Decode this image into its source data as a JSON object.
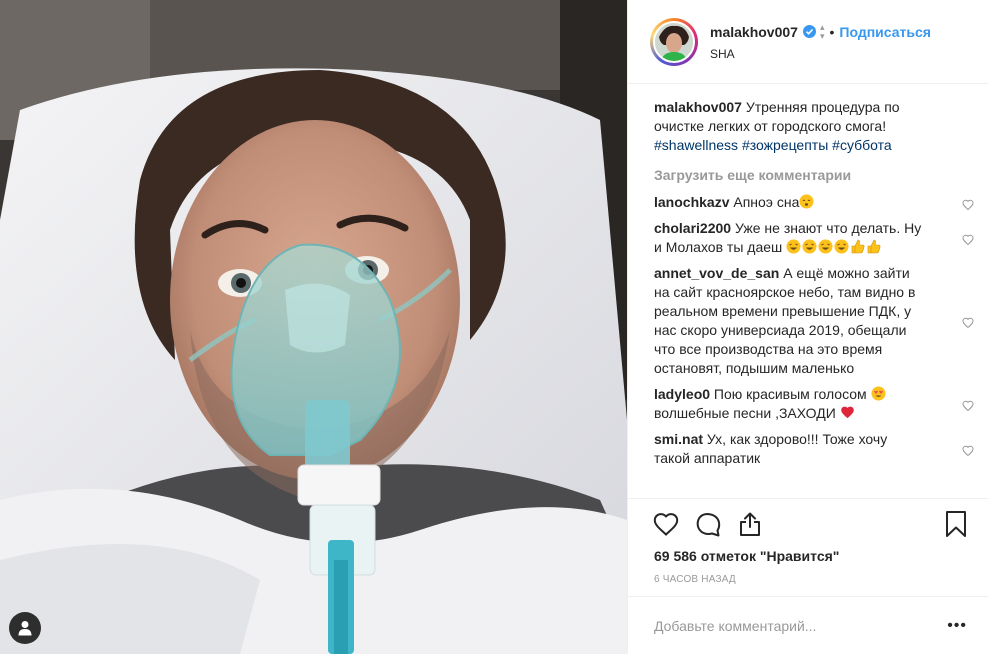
{
  "post": {
    "username": "malakhov007",
    "follow_label": "Подписаться",
    "location": "SHA",
    "caption": {
      "username": "malakhov007",
      "text": "Утренняя процедура по очистке легких от городского смога!",
      "hashtags": [
        "#shawellness",
        "#зожрецепты",
        "#суббота"
      ]
    },
    "load_more_label": "Загрузить еще комментарии",
    "comments": [
      {
        "username": "lanochkazv",
        "text": "Апноэ сна"
      },
      {
        "username": "cholari2200",
        "text": "Уже не знают что делать. Ну и Молахов ты даеш"
      },
      {
        "username": "annet_vov_de_san",
        "text": "А ещё можно зайти на сайт красноярское небо, там видно в реальном времени превышение ПДК, у нас скоро универсиада 2019, обещали что все производства на это время остановят, подышим маленько"
      },
      {
        "username": "ladyleo0",
        "text": "Пою красивым голосом",
        "text2": "волшебные песни ,ЗАХОДИ"
      },
      {
        "username": "smi.nat",
        "text": "Ух, как здорово!!! Тоже хочу такой аппаратик"
      }
    ],
    "likes": "69 586 отметок \"Нравится\"",
    "time_ago": "6 часов назад",
    "add_comment_placeholder": "Добавьте комментарий...",
    "more_options": "•••"
  },
  "colors": {
    "accent_blue": "#3897f0",
    "hashtag": "#003569",
    "muted_text": "#999999",
    "heart_red": "#ed4956"
  },
  "icons": [
    "user-tag-icon",
    "verified-badge-icon",
    "heart-icon",
    "comment-icon",
    "share-icon",
    "bookmark-icon"
  ]
}
